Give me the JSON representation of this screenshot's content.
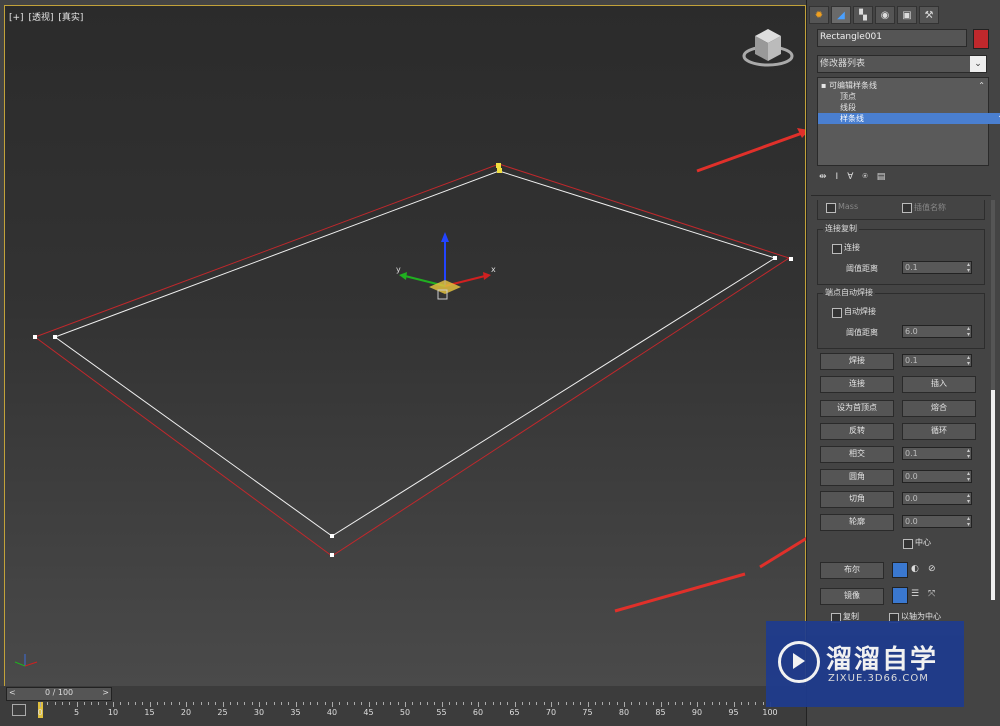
{
  "viewport": {
    "labels": [
      "[+]",
      "[透视]",
      "[真实]"
    ]
  },
  "timeline": {
    "slider_text": "0 / 100",
    "prev": "<",
    "next": ">",
    "ticks": [
      "0",
      "5",
      "10",
      "15",
      "20",
      "25",
      "30",
      "35",
      "40",
      "45",
      "50",
      "55",
      "60",
      "65",
      "70",
      "75",
      "80",
      "85",
      "90",
      "95",
      "100"
    ]
  },
  "panel": {
    "tabs": [
      "create-icon",
      "modify-icon",
      "hierarchy-icon",
      "motion-icon",
      "display-icon",
      "utilities-icon"
    ],
    "object_name": "Rectangle001",
    "object_color": "#c0282c",
    "modifier_list": "修改器列表",
    "stack": {
      "root": "可编辑样条线",
      "sub1": "顶点",
      "sub2": "线段",
      "sub3": "样条线"
    },
    "top_partial": "Mass",
    "top_partial2": "插值名称",
    "connect_copy": {
      "title": "连接复制",
      "checkbox": "连接",
      "threshold_label": "阈值距离",
      "threshold_value": "0.1"
    },
    "endpoint_weld": {
      "title": "端点自动焊接",
      "checkbox": "自动焊接",
      "threshold_label": "阈值距离",
      "threshold_value": "6.0"
    },
    "buttons": {
      "weld": "焊接",
      "weld_value": "0.1",
      "connect": "连接",
      "insert": "插入",
      "make_first": "设为首顶点",
      "fuse": "熔合",
      "reverse": "反转",
      "cycle": "循环",
      "crossinsert": "相交",
      "crossinsert_value": "0.1",
      "fillet": "圆角",
      "fillet_value": "0.0",
      "chamfer": "切角",
      "chamfer_value": "0.0",
      "outline": "轮廓",
      "outline_value": "0.0",
      "center": "中心",
      "boolean": "布尔",
      "mirror": "镜像",
      "copy": "复制",
      "about_pivot": "以轴为中心"
    }
  },
  "watermark": {
    "title": "溜溜自学",
    "url": "ZIXUE.3D66.COM"
  },
  "colors": {
    "selection": "#4a7fd0",
    "viewport_border": "#c2a23a",
    "shape_red": "#c0282c",
    "arrow": "#e0302a"
  }
}
